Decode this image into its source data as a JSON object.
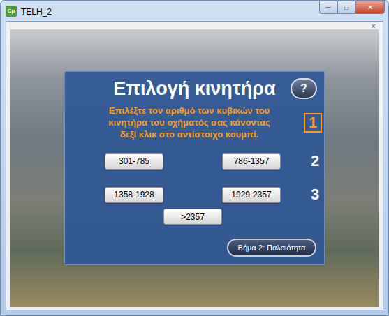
{
  "window": {
    "title": "TELH_2",
    "app_icon": "Cp",
    "controls": [
      "─",
      "□",
      "✕"
    ],
    "inner_close": "×"
  },
  "panel": {
    "title": "Επιλογή κινητήρα",
    "help": "?",
    "instruction": {
      "lines": [
        "Επιλέξτε τον αριθμό των κυβικών του",
        "κινητήρα του οχήματός σας κάνοντας",
        "δεξί κλικ στο αντίστοιχο κουμπί."
      ],
      "step": {
        "label": "1",
        "highlighted": true
      }
    },
    "rows": [
      {
        "buttons": [
          "301-785",
          "786-1357"
        ],
        "step": {
          "label": "2",
          "highlighted": false
        }
      },
      {
        "buttons": [
          "1358-1928",
          "1929-2357"
        ],
        "step": {
          "label": "3",
          "highlighted": false
        }
      },
      {
        "buttons": [
          ">2357"
        ]
      }
    ],
    "next_button": "Βήμα 2: Παλαιότητα"
  }
}
